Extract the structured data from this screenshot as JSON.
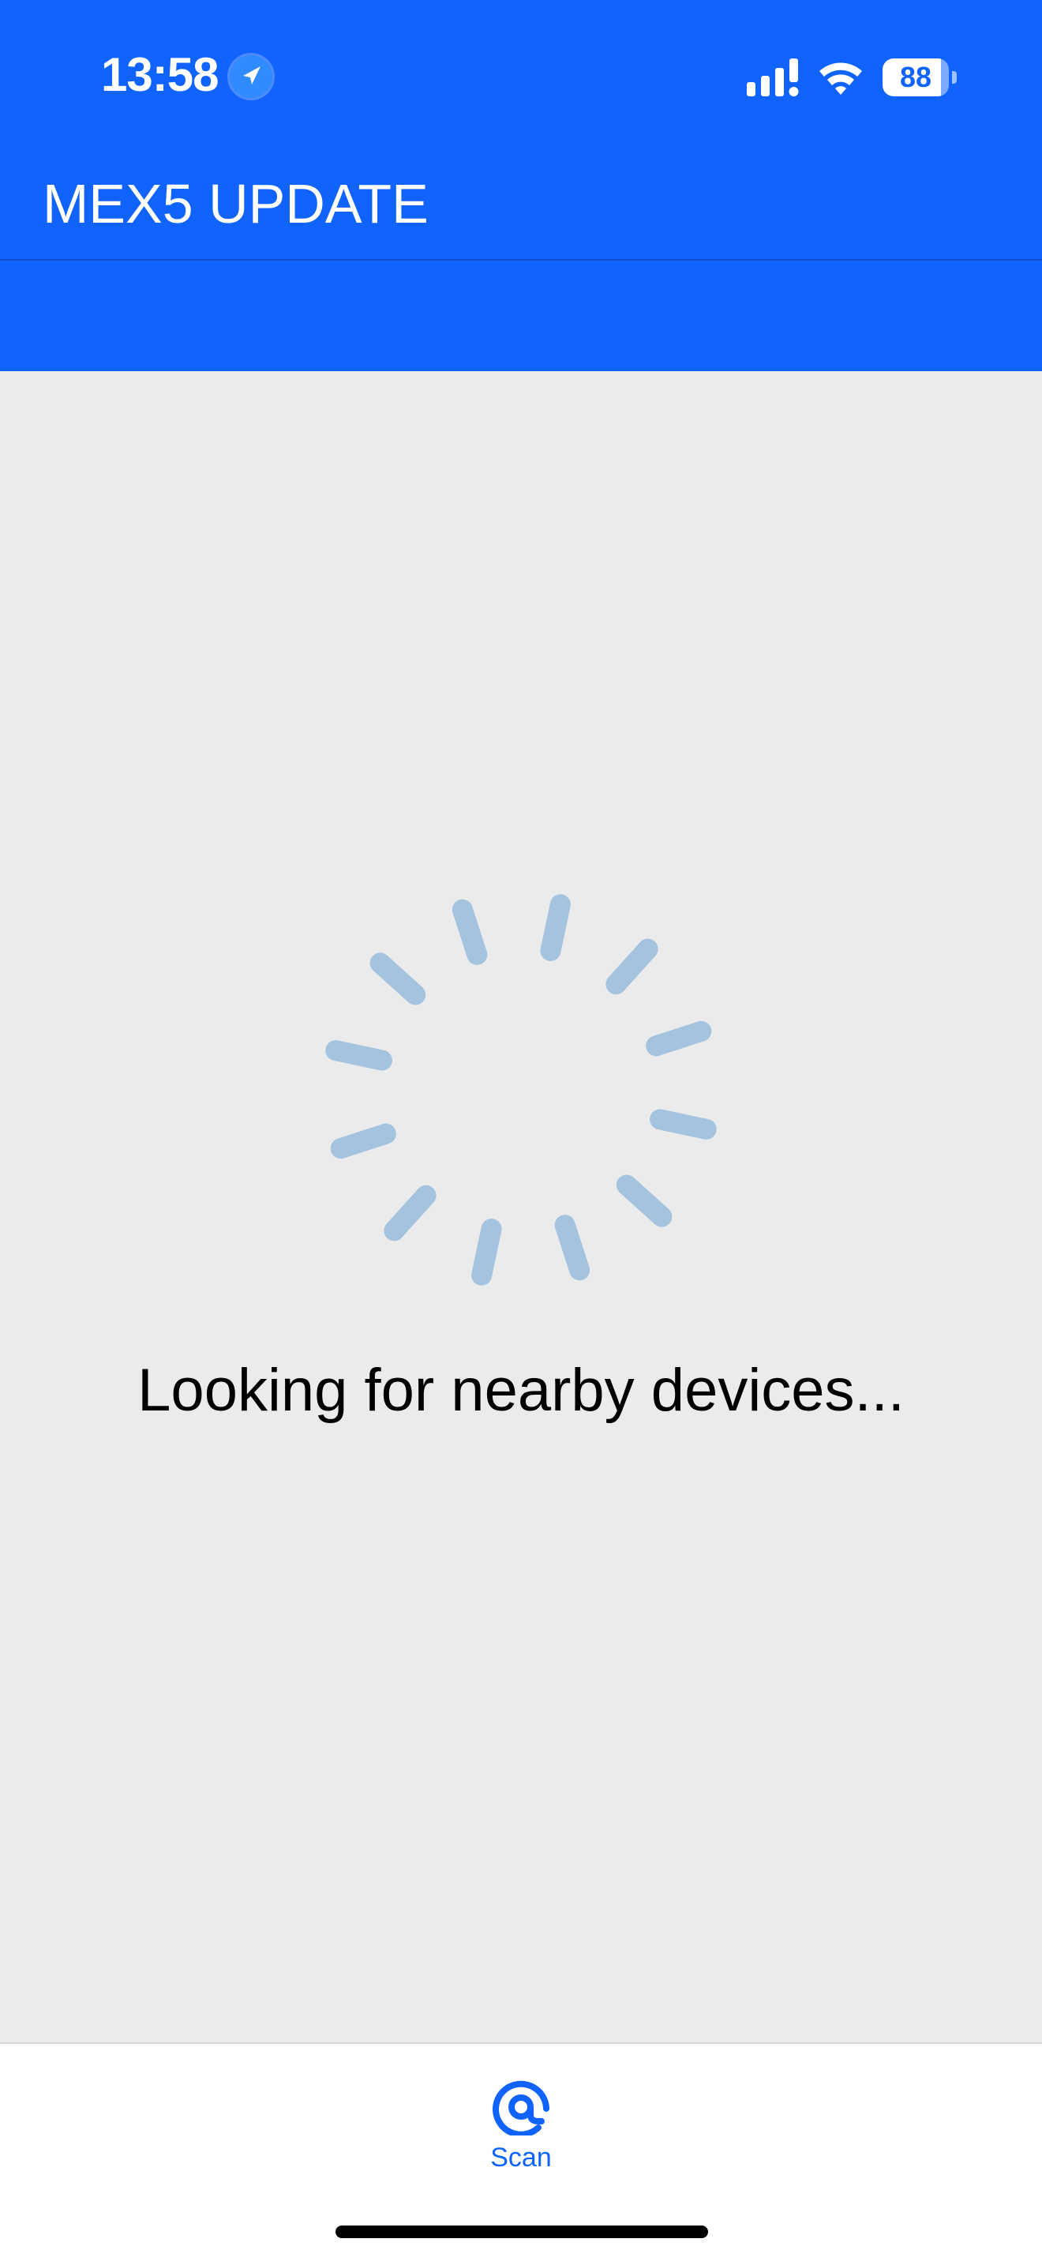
{
  "status_bar": {
    "time": "13:58",
    "battery_level": "88",
    "battery_fraction": 0.88,
    "icons": [
      "location-arrow-icon",
      "cellular-signal-icon",
      "wifi-icon",
      "battery-icon"
    ]
  },
  "app_bar": {
    "title": "MEX5 UPDATE"
  },
  "main": {
    "loading_text": "Looking for nearby devices..."
  },
  "tab_bar": {
    "tabs": [
      {
        "label": "Scan",
        "icon": "scan-icon",
        "selected": true
      }
    ]
  },
  "colors": {
    "brand_blue": "#1064fd",
    "background": "#ebebeb",
    "spinner": "#a4c3de",
    "tab_bar": "#ffffff"
  }
}
